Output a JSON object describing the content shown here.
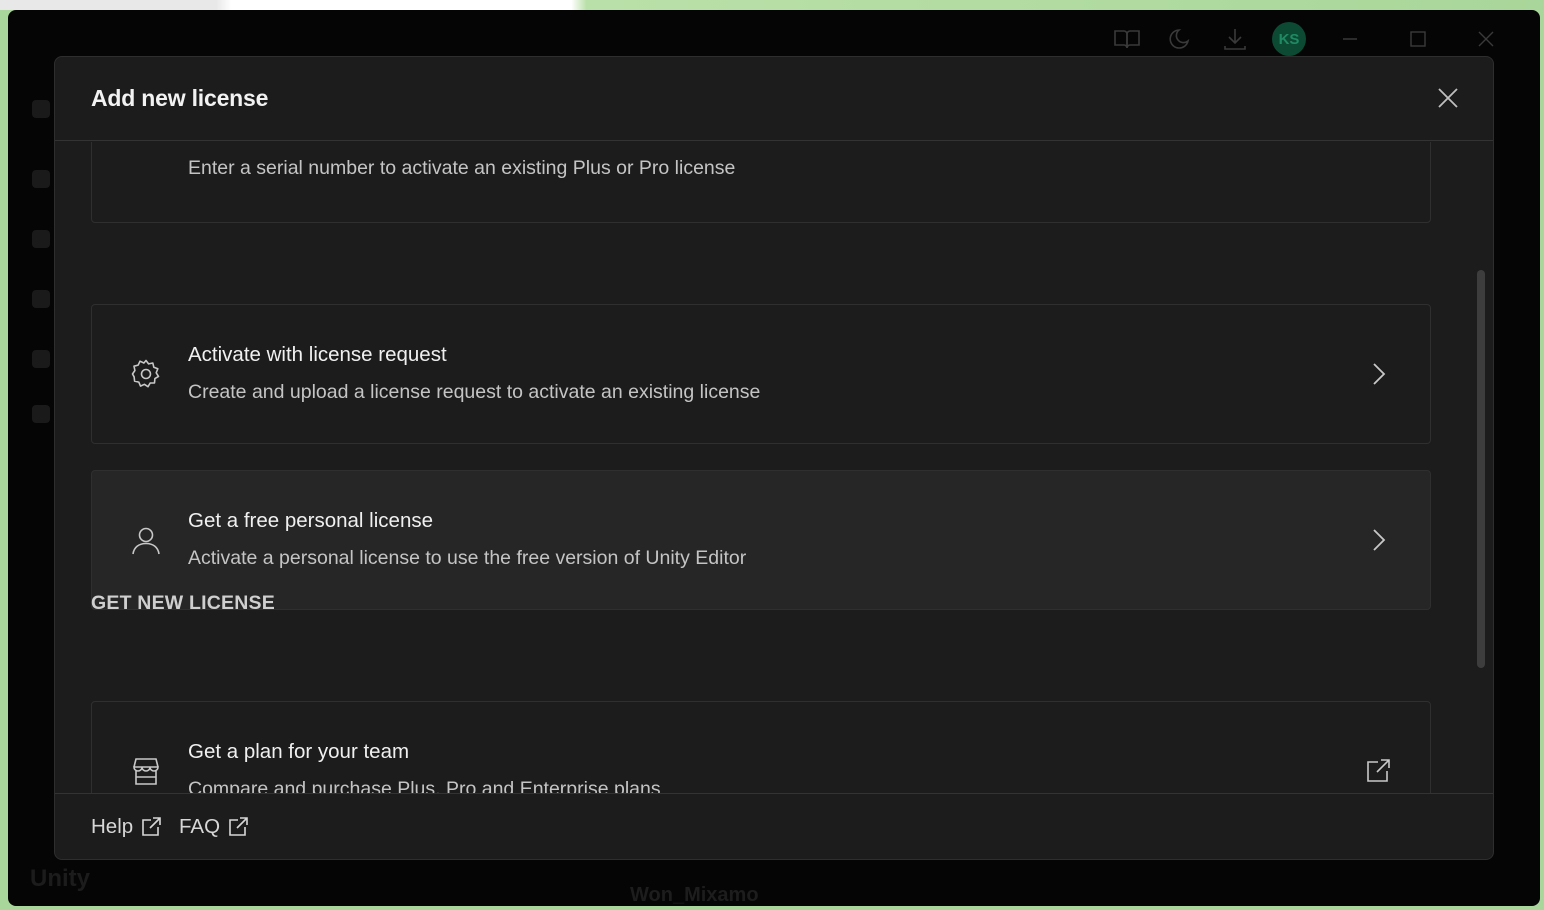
{
  "background_app": {
    "avatar_initials": "KS",
    "brand_text": "Unity",
    "footer_text": "Won_Mixamo"
  },
  "modal": {
    "title": "Add new license",
    "activate_items": [
      {
        "title": "",
        "description": "Enter a serial number to activate an existing Plus or Pro license",
        "icon": "key-icon",
        "action": "chevron-right-icon"
      },
      {
        "title": "Activate with license request",
        "description": "Create and upload a license request to activate an existing license",
        "icon": "gear-icon",
        "action": "chevron-right-icon"
      },
      {
        "title": "Get a free personal license",
        "description": "Activate a personal license to use the free version of Unity Editor",
        "icon": "user-icon",
        "action": "chevron-right-icon"
      }
    ],
    "get_new_heading": "GET NEW LICENSE",
    "get_new_items": [
      {
        "title": "Get a plan for your team",
        "description": "Compare and purchase Plus, Pro and Enterprise plans",
        "icon": "store-icon",
        "action": "external-link-icon"
      }
    ],
    "footer": {
      "help_label": "Help",
      "faq_label": "FAQ"
    }
  },
  "colors": {
    "modal_bg": "#1c1c1c",
    "card_border": "#2f2f2f",
    "hover_card_bg": "#262626",
    "title_text": "#f2f2f2",
    "desc_text": "#c4c4c4"
  }
}
